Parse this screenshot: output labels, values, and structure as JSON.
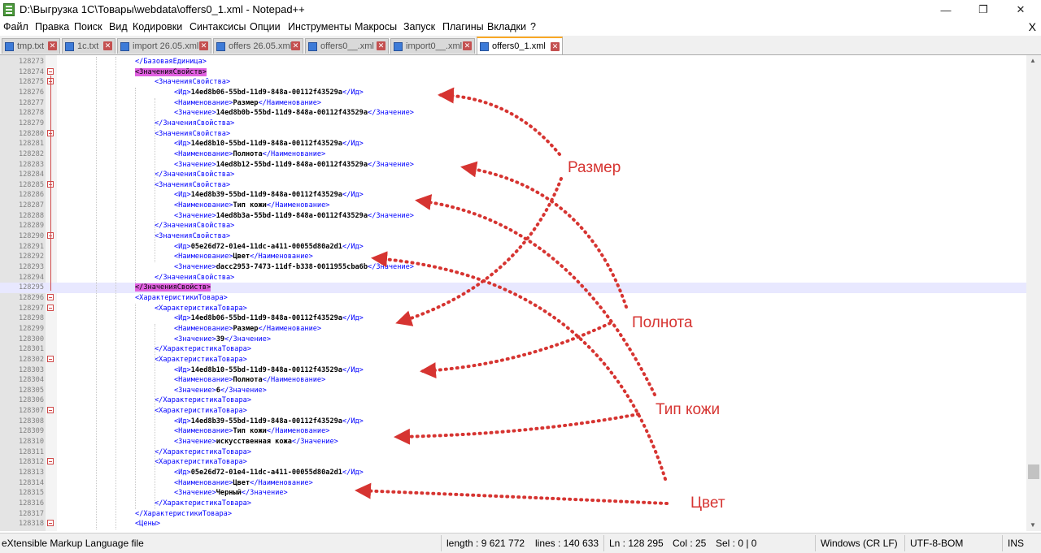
{
  "window": {
    "title": "D:\\Выгрузка 1С\\Товары\\webdata\\offers0_1.xml - Notepad++",
    "minimize": "—",
    "maximize": "❐",
    "close": "✕"
  },
  "menu": {
    "items": [
      "Файл",
      "Правка",
      "Поиск",
      "Вид",
      "Кодировки",
      "Синтаксисы",
      "Опции",
      "Инструменты",
      "Макросы",
      "Запуск",
      "Плагины",
      "Вкладки",
      "?"
    ],
    "close": "X"
  },
  "tabs": [
    {
      "label": "tmp.txt",
      "active": false
    },
    {
      "label": "1c.txt",
      "active": false
    },
    {
      "label": "import 26.05.xml",
      "active": false
    },
    {
      "label": "offers 26.05.xml",
      "active": false
    },
    {
      "label": "offers0__.xml",
      "active": false
    },
    {
      "label": "import0__.xml",
      "active": false
    },
    {
      "label": "offers0_1.xml",
      "active": true
    }
  ],
  "editor": {
    "current_line": 128295,
    "lines": [
      {
        "n": "128273",
        "indent": 2,
        "parts": [
          [
            "tag",
            "</БазоваяЕдиница>"
          ]
        ]
      },
      {
        "n": "128274",
        "indent": 2,
        "fold": true,
        "parts": [
          [
            "hl",
            "<ЗначенияСвойств>"
          ]
        ]
      },
      {
        "n": "128275",
        "indent": 3,
        "fold": true,
        "parts": [
          [
            "tag",
            "<ЗначенияСвойства>"
          ]
        ]
      },
      {
        "n": "128276",
        "indent": 4,
        "parts": [
          [
            "tag",
            "<Ид>"
          ],
          [
            "txt",
            "14ed8b06-55bd-11d9-848a-00112f43529a"
          ],
          [
            "tag",
            "</Ид>"
          ]
        ]
      },
      {
        "n": "128277",
        "indent": 4,
        "parts": [
          [
            "tag",
            "<Наименование>"
          ],
          [
            "txt",
            "Размер"
          ],
          [
            "tag",
            "</Наименование>"
          ]
        ]
      },
      {
        "n": "128278",
        "indent": 4,
        "parts": [
          [
            "tag",
            "<Значение>"
          ],
          [
            "txt",
            "14ed8b0b-55bd-11d9-848a-00112f43529a"
          ],
          [
            "tag",
            "</Значение>"
          ]
        ]
      },
      {
        "n": "128279",
        "indent": 3,
        "parts": [
          [
            "tag",
            "</ЗначенияСвойства>"
          ]
        ]
      },
      {
        "n": "128280",
        "indent": 3,
        "fold": true,
        "parts": [
          [
            "tag",
            "<ЗначенияСвойства>"
          ]
        ]
      },
      {
        "n": "128281",
        "indent": 4,
        "parts": [
          [
            "tag",
            "<Ид>"
          ],
          [
            "txt",
            "14ed8b10-55bd-11d9-848a-00112f43529a"
          ],
          [
            "tag",
            "</Ид>"
          ]
        ]
      },
      {
        "n": "128282",
        "indent": 4,
        "parts": [
          [
            "tag",
            "<Наименование>"
          ],
          [
            "txt",
            "Полнота"
          ],
          [
            "tag",
            "</Наименование>"
          ]
        ]
      },
      {
        "n": "128283",
        "indent": 4,
        "parts": [
          [
            "tag",
            "<Значение>"
          ],
          [
            "txt",
            "14ed8b12-55bd-11d9-848a-00112f43529a"
          ],
          [
            "tag",
            "</Значение>"
          ]
        ]
      },
      {
        "n": "128284",
        "indent": 3,
        "parts": [
          [
            "tag",
            "</ЗначенияСвойства>"
          ]
        ]
      },
      {
        "n": "128285",
        "indent": 3,
        "fold": true,
        "parts": [
          [
            "tag",
            "<ЗначенияСвойства>"
          ]
        ]
      },
      {
        "n": "128286",
        "indent": 4,
        "parts": [
          [
            "tag",
            "<Ид>"
          ],
          [
            "txt",
            "14ed8b39-55bd-11d9-848a-00112f43529a"
          ],
          [
            "tag",
            "</Ид>"
          ]
        ]
      },
      {
        "n": "128287",
        "indent": 4,
        "parts": [
          [
            "tag",
            "<Наименование>"
          ],
          [
            "txt",
            "Тип кожи"
          ],
          [
            "tag",
            "</Наименование>"
          ]
        ]
      },
      {
        "n": "128288",
        "indent": 4,
        "parts": [
          [
            "tag",
            "<Значение>"
          ],
          [
            "txt",
            "14ed8b3a-55bd-11d9-848a-00112f43529a"
          ],
          [
            "tag",
            "</Значение>"
          ]
        ]
      },
      {
        "n": "128289",
        "indent": 3,
        "parts": [
          [
            "tag",
            "</ЗначенияСвойства>"
          ]
        ]
      },
      {
        "n": "128290",
        "indent": 3,
        "fold": true,
        "parts": [
          [
            "tag",
            "<ЗначенияСвойства>"
          ]
        ]
      },
      {
        "n": "128291",
        "indent": 4,
        "parts": [
          [
            "tag",
            "<Ид>"
          ],
          [
            "txt",
            "05e26d72-01e4-11dc-a411-00055d80a2d1"
          ],
          [
            "tag",
            "</Ид>"
          ]
        ]
      },
      {
        "n": "128292",
        "indent": 4,
        "parts": [
          [
            "tag",
            "<Наименование>"
          ],
          [
            "txt",
            "Цвет"
          ],
          [
            "tag",
            "</Наименование>"
          ]
        ]
      },
      {
        "n": "128293",
        "indent": 4,
        "parts": [
          [
            "tag",
            "<Значение>"
          ],
          [
            "txt",
            "dacc2953-7473-11df-b338-0011955cba6b"
          ],
          [
            "tag",
            "</Значение>"
          ]
        ]
      },
      {
        "n": "128294",
        "indent": 3,
        "parts": [
          [
            "tag",
            "</ЗначенияСвойства>"
          ]
        ]
      },
      {
        "n": "128295",
        "indent": 2,
        "parts": [
          [
            "hl",
            "</ЗначенияСвойств>"
          ]
        ]
      },
      {
        "n": "128296",
        "indent": 2,
        "fold": true,
        "parts": [
          [
            "tag",
            "<ХарактеристикиТовара>"
          ]
        ]
      },
      {
        "n": "128297",
        "indent": 3,
        "fold": true,
        "parts": [
          [
            "tag",
            "<ХарактеристикаТовара>"
          ]
        ]
      },
      {
        "n": "128298",
        "indent": 4,
        "parts": [
          [
            "tag",
            "<Ид>"
          ],
          [
            "txt",
            "14ed8b06-55bd-11d9-848a-00112f43529a"
          ],
          [
            "tag",
            "</Ид>"
          ]
        ]
      },
      {
        "n": "128299",
        "indent": 4,
        "parts": [
          [
            "tag",
            "<Наименование>"
          ],
          [
            "txt",
            "Размер"
          ],
          [
            "tag",
            "</Наименование>"
          ]
        ]
      },
      {
        "n": "128300",
        "indent": 4,
        "parts": [
          [
            "tag",
            "<Значение>"
          ],
          [
            "txt",
            "39"
          ],
          [
            "tag",
            "</Значение>"
          ]
        ]
      },
      {
        "n": "128301",
        "indent": 3,
        "parts": [
          [
            "tag",
            "</ХарактеристикаТовара>"
          ]
        ]
      },
      {
        "n": "128302",
        "indent": 3,
        "fold": true,
        "parts": [
          [
            "tag",
            "<ХарактеристикаТовара>"
          ]
        ]
      },
      {
        "n": "128303",
        "indent": 4,
        "parts": [
          [
            "tag",
            "<Ид>"
          ],
          [
            "txt",
            "14ed8b10-55bd-11d9-848a-00112f43529a"
          ],
          [
            "tag",
            "</Ид>"
          ]
        ]
      },
      {
        "n": "128304",
        "indent": 4,
        "parts": [
          [
            "tag",
            "<Наименование>"
          ],
          [
            "txt",
            "Полнота"
          ],
          [
            "tag",
            "</Наименование>"
          ]
        ]
      },
      {
        "n": "128305",
        "indent": 4,
        "parts": [
          [
            "tag",
            "<Значение>"
          ],
          [
            "txt",
            "6"
          ],
          [
            "tag",
            "</Значение>"
          ]
        ]
      },
      {
        "n": "128306",
        "indent": 3,
        "parts": [
          [
            "tag",
            "</ХарактеристикаТовара>"
          ]
        ]
      },
      {
        "n": "128307",
        "indent": 3,
        "fold": true,
        "parts": [
          [
            "tag",
            "<ХарактеристикаТовара>"
          ]
        ]
      },
      {
        "n": "128308",
        "indent": 4,
        "parts": [
          [
            "tag",
            "<Ид>"
          ],
          [
            "txt",
            "14ed8b39-55bd-11d9-848a-00112f43529a"
          ],
          [
            "tag",
            "</Ид>"
          ]
        ]
      },
      {
        "n": "128309",
        "indent": 4,
        "parts": [
          [
            "tag",
            "<Наименование>"
          ],
          [
            "txt",
            "Тип кожи"
          ],
          [
            "tag",
            "</Наименование>"
          ]
        ]
      },
      {
        "n": "128310",
        "indent": 4,
        "parts": [
          [
            "tag",
            "<Значение>"
          ],
          [
            "txt",
            "искусственная кожа"
          ],
          [
            "tag",
            "</Значение>"
          ]
        ]
      },
      {
        "n": "128311",
        "indent": 3,
        "parts": [
          [
            "tag",
            "</ХарактеристикаТовара>"
          ]
        ]
      },
      {
        "n": "128312",
        "indent": 3,
        "fold": true,
        "parts": [
          [
            "tag",
            "<ХарактеристикаТовара>"
          ]
        ]
      },
      {
        "n": "128313",
        "indent": 4,
        "parts": [
          [
            "tag",
            "<Ид>"
          ],
          [
            "txt",
            "05e26d72-01e4-11dc-a411-00055d80a2d1"
          ],
          [
            "tag",
            "</Ид>"
          ]
        ]
      },
      {
        "n": "128314",
        "indent": 4,
        "parts": [
          [
            "tag",
            "<Наименование>"
          ],
          [
            "txt",
            "Цвет"
          ],
          [
            "tag",
            "</Наименование>"
          ]
        ]
      },
      {
        "n": "128315",
        "indent": 4,
        "parts": [
          [
            "tag",
            "<Значение>"
          ],
          [
            "txt",
            "Черный"
          ],
          [
            "tag",
            "</Значение>"
          ]
        ]
      },
      {
        "n": "128316",
        "indent": 3,
        "parts": [
          [
            "tag",
            "</ХарактеристикаТовара>"
          ]
        ]
      },
      {
        "n": "128317",
        "indent": 2,
        "parts": [
          [
            "tag",
            "</ХарактеристикиТовара>"
          ]
        ]
      },
      {
        "n": "128318",
        "indent": 2,
        "fold": true,
        "parts": [
          [
            "tag",
            "<Цены>"
          ]
        ]
      }
    ]
  },
  "annotations": [
    {
      "label": "Размер",
      "color": "#d63431"
    },
    {
      "label": "Полнота",
      "color": "#d63431"
    },
    {
      "label": "Тип кожи",
      "color": "#d63431"
    },
    {
      "label": "Цвет",
      "color": "#d63431"
    }
  ],
  "status": {
    "file_type": "eXtensible Markup Language file",
    "length": "length : 9 621 772",
    "lines": "lines : 140 633",
    "ln": "Ln : 128 295",
    "col": "Col : 25",
    "sel": "Sel : 0 | 0",
    "eol": "Windows (CR LF)",
    "encoding": "UTF-8-BOM",
    "mode": "INS"
  },
  "colors": {
    "tag": "#0000ff",
    "highlight": "#e060e0",
    "annotation": "#d63431",
    "fold_marker": "#d04848"
  }
}
